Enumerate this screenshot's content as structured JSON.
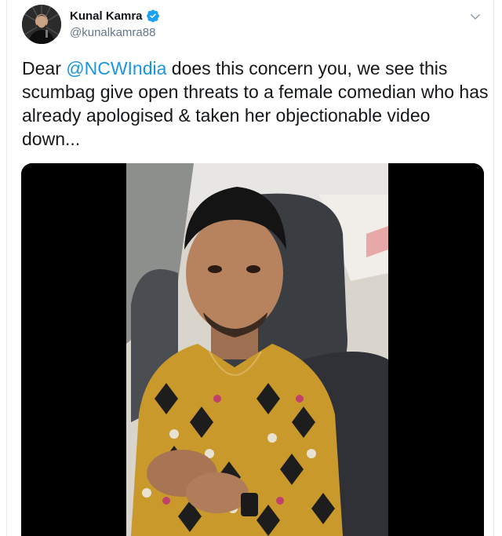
{
  "author": {
    "display_name": "Kunal Kamra",
    "handle": "@kunalkamra88",
    "verified": true,
    "avatar_icon": "avatar-photo"
  },
  "tweet": {
    "text_before": "Dear ",
    "mention": "@NCWIndia",
    "text_after": " does this concern you, we see this scumbag give open threats to a female comedian who has already apologised & taken her objectionable video down..."
  },
  "colors": {
    "link": "#1b95e0",
    "verified_badge": "#1da1f2",
    "secondary_text": "#657786"
  },
  "media": {
    "type": "video",
    "icon": "video-thumbnail"
  }
}
